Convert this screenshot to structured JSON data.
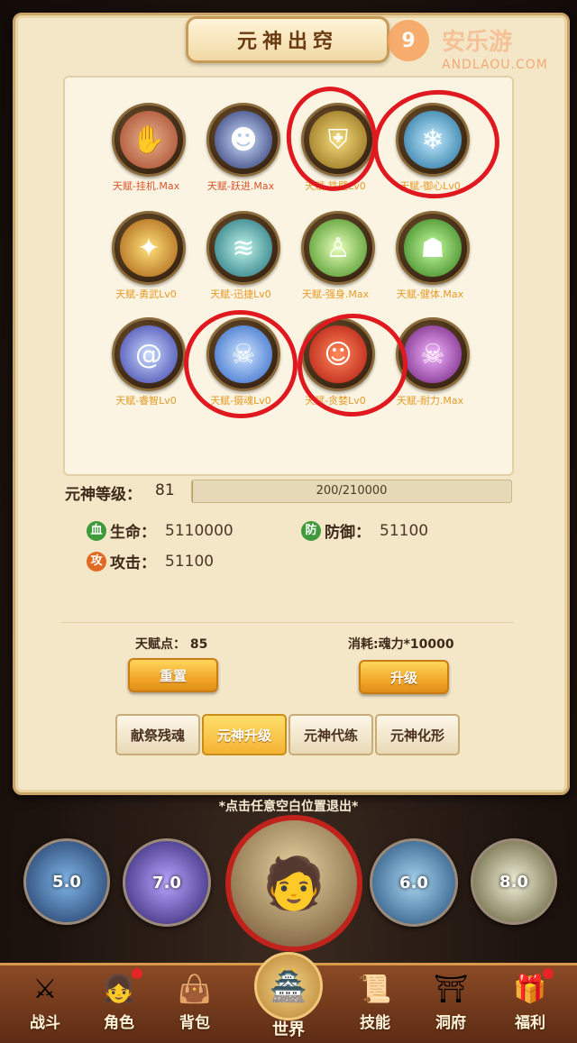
{
  "panel": {
    "title": "元神出窍"
  },
  "watermark": {
    "logo": "9",
    "text": "安乐游",
    "url": "ANDLAOU.COM"
  },
  "talents": [
    {
      "label": "天赋-挂机.Max",
      "icon": "hand-icon",
      "status": "max"
    },
    {
      "label": "天赋-跃进.Max",
      "icon": "shadow-icon",
      "status": "max"
    },
    {
      "label": "天赋-铁壁Lv0",
      "icon": "shield-icon",
      "status": "lv0"
    },
    {
      "label": "天赋-御心Lv0",
      "icon": "ice-icon",
      "status": "lv0"
    },
    {
      "label": "天赋-勇武Lv0",
      "icon": "flame-icon",
      "status": "lv0"
    },
    {
      "label": "天赋-迅捷Lv0",
      "icon": "wind-icon",
      "status": "lv0"
    },
    {
      "label": "天赋-强身.Max",
      "icon": "figures-icon",
      "status": "max-o"
    },
    {
      "label": "天赋-健体.Max",
      "icon": "muscle-icon",
      "status": "max-o"
    },
    {
      "label": "天赋-睿智Lv0",
      "icon": "vortex-icon",
      "status": "lv0"
    },
    {
      "label": "天赋-摄魂Lv0",
      "icon": "skull-icon",
      "status": "lv0"
    },
    {
      "label": "天赋-贪婪Lv0",
      "icon": "ghost-icon",
      "status": "lv0"
    },
    {
      "label": "天赋-耐力.Max",
      "icon": "demon-icon",
      "status": "max-o"
    }
  ],
  "level": {
    "label": "元神等级：",
    "value": "81",
    "progress_text": "200/210000",
    "progress_fraction": 0.001
  },
  "stats": {
    "hp": {
      "badge": "血",
      "name": "生命：",
      "value": "5110000"
    },
    "def": {
      "badge": "防",
      "name": "防御：",
      "value": "51100"
    },
    "atk": {
      "badge": "攻",
      "name": "攻击：",
      "value": "51100"
    }
  },
  "talent_points": "天赋点：  85",
  "cost": "消耗:魂力*10000",
  "buttons": {
    "reset": "重置",
    "upgrade": "升级"
  },
  "tabs": [
    {
      "label": "献祭残魂",
      "active": false
    },
    {
      "label": "元神升级",
      "active": true
    },
    {
      "label": "元神代练",
      "active": false
    },
    {
      "label": "元神化形",
      "active": false
    }
  ],
  "exit_hint": "*点击任意空白位置退出*",
  "skills": [
    {
      "cooldown": "5.0",
      "icon": "lightning-icon"
    },
    {
      "cooldown": "7.0",
      "icon": "spirit-icon"
    },
    {
      "cooldown": "6.0",
      "icon": "slash-icon"
    },
    {
      "cooldown": "8.0",
      "icon": "light-icon"
    }
  ],
  "hero": {
    "icon": "hero-portrait-icon"
  },
  "nav": {
    "battle": "战斗",
    "role": "角色",
    "bag": "背包",
    "world": "世界",
    "skill": "技能",
    "cave": "洞府",
    "welfare": "福利"
  },
  "colors": {
    "accent": "#f2a72a",
    "highlight_circle": "#e0181f",
    "label_max": "#d9532b",
    "label_lv0": "#e59a26"
  }
}
